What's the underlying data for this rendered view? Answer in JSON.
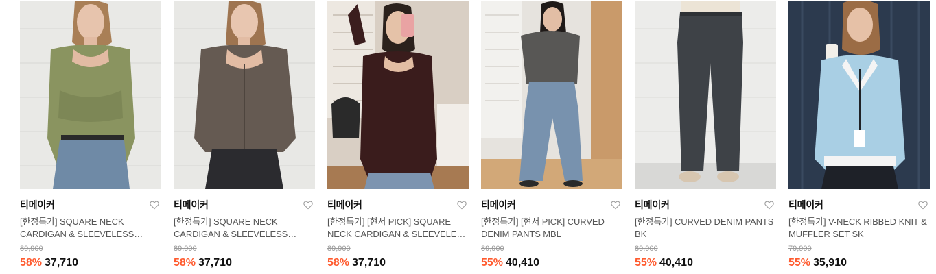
{
  "colors": {
    "discount": "#ff5a2e",
    "brand": "#111111",
    "title": "#555555",
    "original_price": "#9a9a9a"
  },
  "products": [
    {
      "brand": "티메이커",
      "title": "[한정특가] SQUARE NECK CARDIGAN & SLEEVELESS SET…",
      "original_price": "89,900",
      "discount": "58%",
      "price": "37,710",
      "icon": "heart-icon"
    },
    {
      "brand": "티메이커",
      "title": "[한정특가] SQUARE NECK CARDIGAN & SLEEVELESS SET…",
      "original_price": "89,900",
      "discount": "58%",
      "price": "37,710",
      "icon": "heart-icon"
    },
    {
      "brand": "티메이커",
      "title": "[한정특가] [현서 PICK] SQUARE NECK CARDIGAN & SLEEVELE…",
      "original_price": "89,900",
      "discount": "58%",
      "price": "37,710",
      "icon": "heart-icon"
    },
    {
      "brand": "티메이커",
      "title": "[한정특가] [현서 PICK] CURVED DENIM PANTS MBL",
      "original_price": "89,900",
      "discount": "55%",
      "price": "40,410",
      "icon": "heart-icon"
    },
    {
      "brand": "티메이커",
      "title": "[한정특가] CURVED DENIM PANTS BK",
      "original_price": "89,900",
      "discount": "55%",
      "price": "40,410",
      "icon": "heart-icon"
    },
    {
      "brand": "티메이커",
      "title": "[한정특가] V-NECK RIBBED KNIT & MUFFLER SET SK",
      "original_price": "79,900",
      "discount": "55%",
      "price": "35,910",
      "icon": "heart-icon"
    }
  ]
}
